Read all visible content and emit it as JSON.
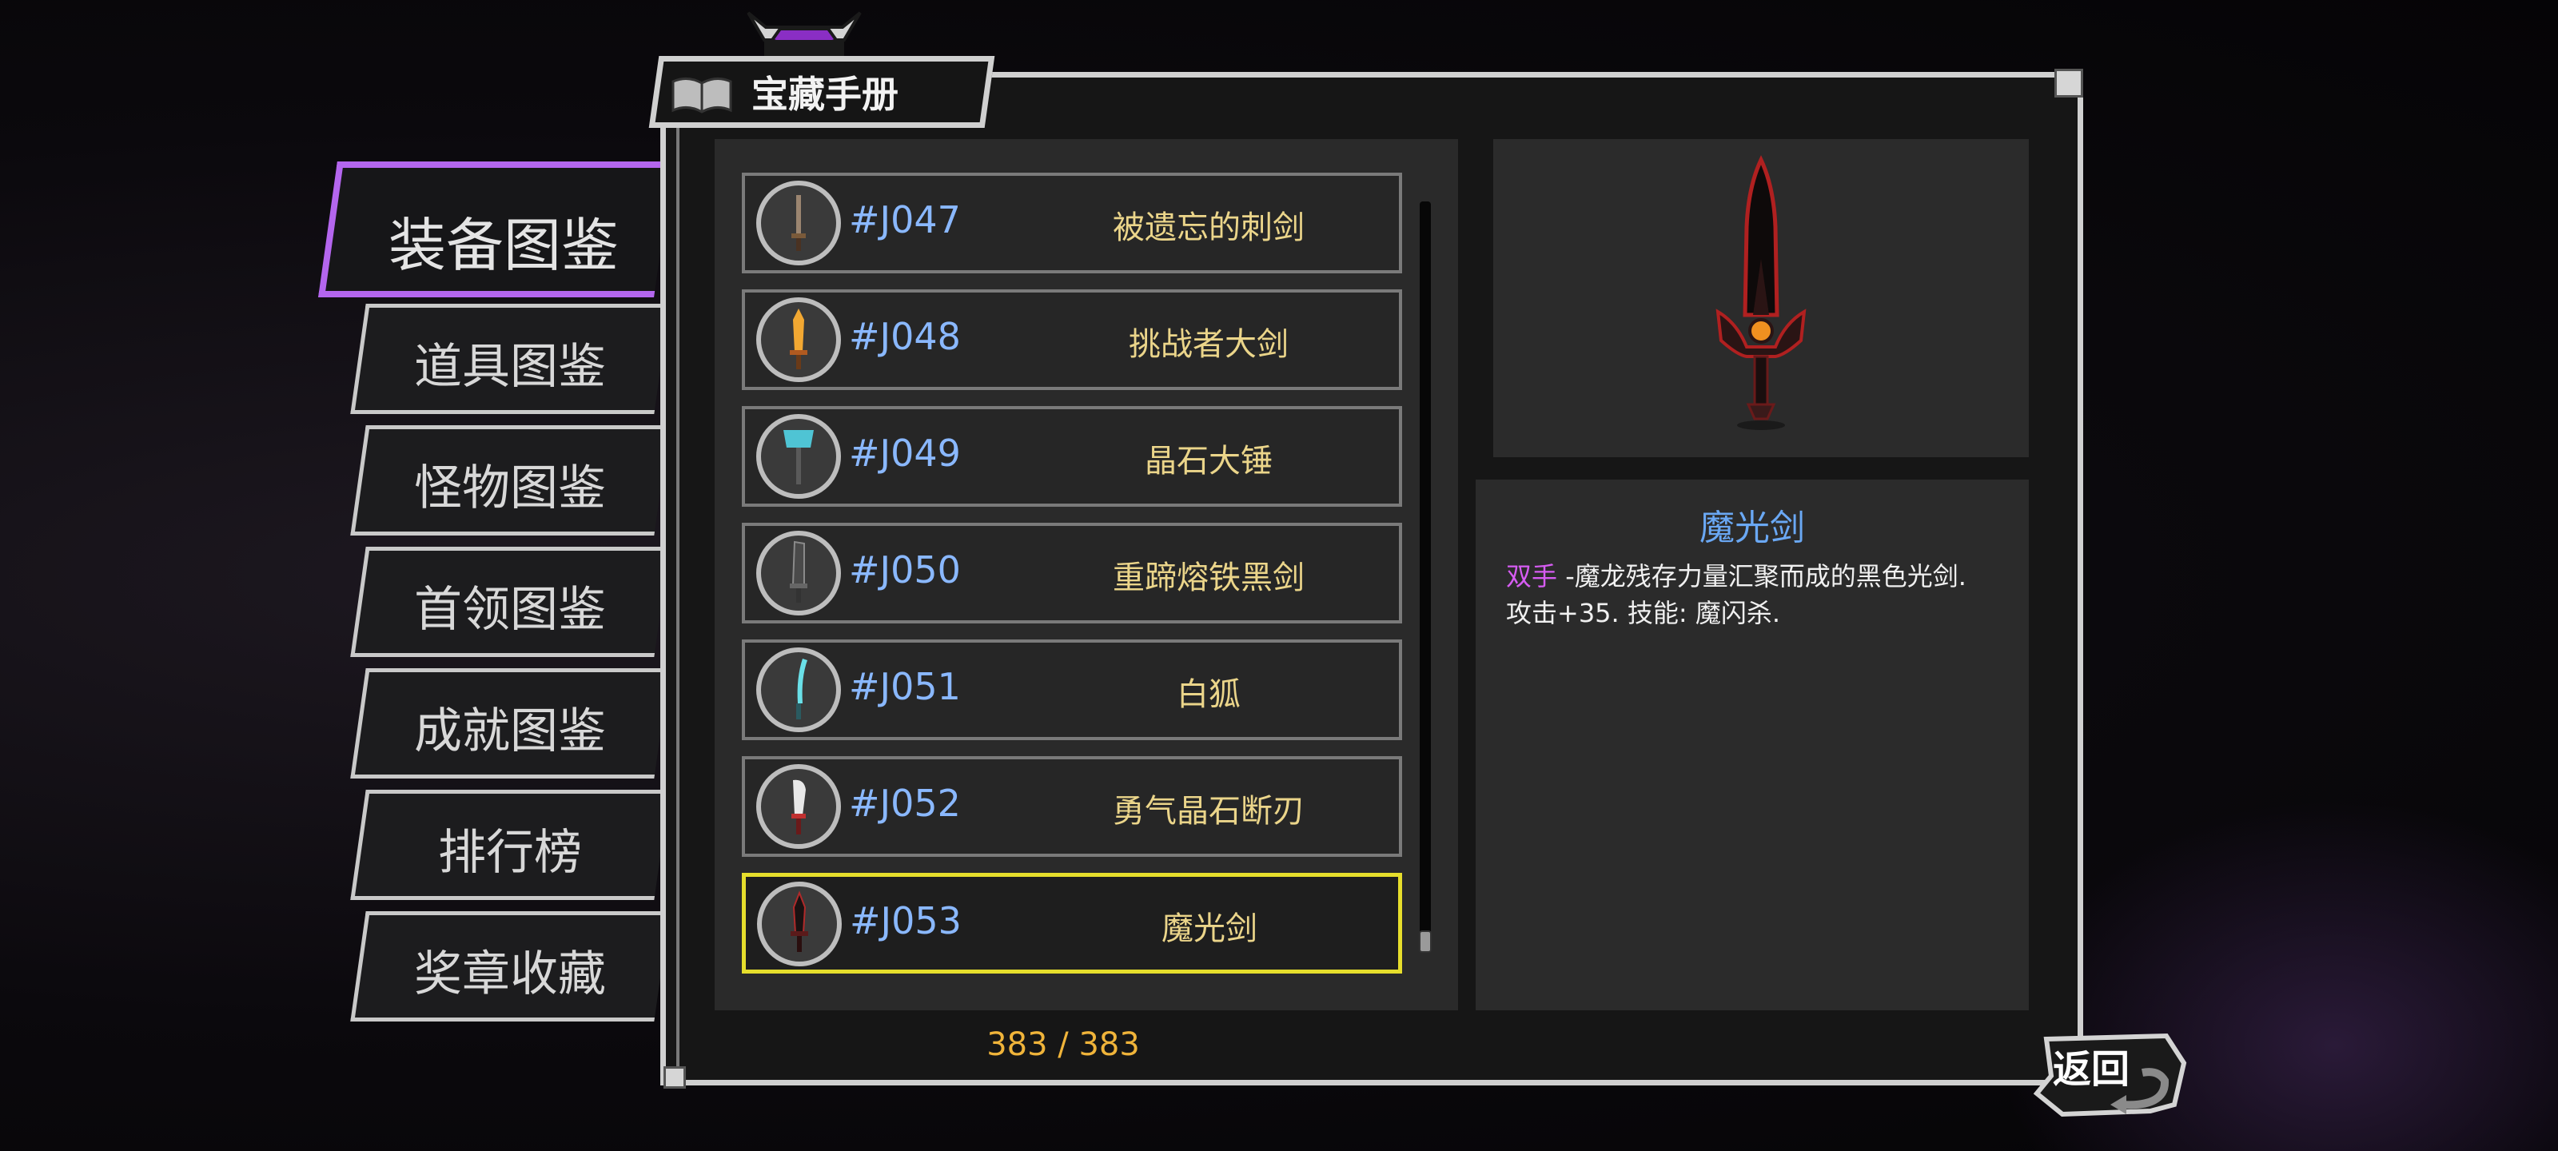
{
  "header": {
    "title": "宝藏手册"
  },
  "sidebar": {
    "tabs": [
      {
        "label": "装备图鉴",
        "active": true
      },
      {
        "label": "道具图鉴",
        "active": false
      },
      {
        "label": "怪物图鉴",
        "active": false
      },
      {
        "label": "首领图鉴",
        "active": false
      },
      {
        "label": "成就图鉴",
        "active": false
      },
      {
        "label": "排行榜",
        "active": false
      },
      {
        "label": "奖章收藏",
        "active": false
      }
    ]
  },
  "list": {
    "items": [
      {
        "code": "#J047",
        "name": "被遗忘的刺剑",
        "icon": "rapier-icon"
      },
      {
        "code": "#J048",
        "name": "挑战者大剑",
        "icon": "greatsword-icon"
      },
      {
        "code": "#J049",
        "name": "晶石大锤",
        "icon": "crystal-hammer-icon"
      },
      {
        "code": "#J050",
        "name": "重蹄熔铁黑剑",
        "icon": "black-sword-icon"
      },
      {
        "code": "#J051",
        "name": "白狐",
        "icon": "white-fox-blade-icon"
      },
      {
        "code": "#J052",
        "name": "勇气晶石断刃",
        "icon": "broken-blade-icon"
      },
      {
        "code": "#J053",
        "name": "魔光剑",
        "icon": "demon-sword-icon",
        "selected": true
      }
    ],
    "count": "383 / 383"
  },
  "detail": {
    "name": "魔光剑",
    "tag": "双手",
    "description": " -魔龙残存力量汇聚而成的黑色光剑.",
    "stats": "攻击+35. 技能: 魔闪杀.",
    "preview_icon": "demon-sword-icon"
  },
  "footer": {
    "back_label": "返回"
  },
  "colors": {
    "accent_purple": "#b466ee",
    "selected_border": "#e6de2c",
    "code_blue": "#8ab8ff",
    "name_gold": "#ebd58a",
    "count_orange": "#f0b43a",
    "title_blue": "#6aa8f4",
    "tag_magenta": "#d65cf2"
  }
}
